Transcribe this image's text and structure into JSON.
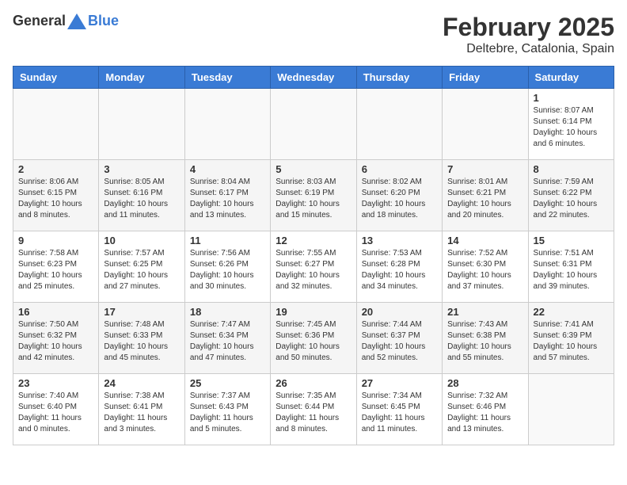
{
  "header": {
    "logo_general": "General",
    "logo_blue": "Blue",
    "month": "February 2025",
    "location": "Deltebre, Catalonia, Spain"
  },
  "days_of_week": [
    "Sunday",
    "Monday",
    "Tuesday",
    "Wednesday",
    "Thursday",
    "Friday",
    "Saturday"
  ],
  "weeks": [
    [
      {
        "day": "",
        "info": ""
      },
      {
        "day": "",
        "info": ""
      },
      {
        "day": "",
        "info": ""
      },
      {
        "day": "",
        "info": ""
      },
      {
        "day": "",
        "info": ""
      },
      {
        "day": "",
        "info": ""
      },
      {
        "day": "1",
        "info": "Sunrise: 8:07 AM\nSunset: 6:14 PM\nDaylight: 10 hours\nand 6 minutes."
      }
    ],
    [
      {
        "day": "2",
        "info": "Sunrise: 8:06 AM\nSunset: 6:15 PM\nDaylight: 10 hours\nand 8 minutes."
      },
      {
        "day": "3",
        "info": "Sunrise: 8:05 AM\nSunset: 6:16 PM\nDaylight: 10 hours\nand 11 minutes."
      },
      {
        "day": "4",
        "info": "Sunrise: 8:04 AM\nSunset: 6:17 PM\nDaylight: 10 hours\nand 13 minutes."
      },
      {
        "day": "5",
        "info": "Sunrise: 8:03 AM\nSunset: 6:19 PM\nDaylight: 10 hours\nand 15 minutes."
      },
      {
        "day": "6",
        "info": "Sunrise: 8:02 AM\nSunset: 6:20 PM\nDaylight: 10 hours\nand 18 minutes."
      },
      {
        "day": "7",
        "info": "Sunrise: 8:01 AM\nSunset: 6:21 PM\nDaylight: 10 hours\nand 20 minutes."
      },
      {
        "day": "8",
        "info": "Sunrise: 7:59 AM\nSunset: 6:22 PM\nDaylight: 10 hours\nand 22 minutes."
      }
    ],
    [
      {
        "day": "9",
        "info": "Sunrise: 7:58 AM\nSunset: 6:23 PM\nDaylight: 10 hours\nand 25 minutes."
      },
      {
        "day": "10",
        "info": "Sunrise: 7:57 AM\nSunset: 6:25 PM\nDaylight: 10 hours\nand 27 minutes."
      },
      {
        "day": "11",
        "info": "Sunrise: 7:56 AM\nSunset: 6:26 PM\nDaylight: 10 hours\nand 30 minutes."
      },
      {
        "day": "12",
        "info": "Sunrise: 7:55 AM\nSunset: 6:27 PM\nDaylight: 10 hours\nand 32 minutes."
      },
      {
        "day": "13",
        "info": "Sunrise: 7:53 AM\nSunset: 6:28 PM\nDaylight: 10 hours\nand 34 minutes."
      },
      {
        "day": "14",
        "info": "Sunrise: 7:52 AM\nSunset: 6:30 PM\nDaylight: 10 hours\nand 37 minutes."
      },
      {
        "day": "15",
        "info": "Sunrise: 7:51 AM\nSunset: 6:31 PM\nDaylight: 10 hours\nand 39 minutes."
      }
    ],
    [
      {
        "day": "16",
        "info": "Sunrise: 7:50 AM\nSunset: 6:32 PM\nDaylight: 10 hours\nand 42 minutes."
      },
      {
        "day": "17",
        "info": "Sunrise: 7:48 AM\nSunset: 6:33 PM\nDaylight: 10 hours\nand 45 minutes."
      },
      {
        "day": "18",
        "info": "Sunrise: 7:47 AM\nSunset: 6:34 PM\nDaylight: 10 hours\nand 47 minutes."
      },
      {
        "day": "19",
        "info": "Sunrise: 7:45 AM\nSunset: 6:36 PM\nDaylight: 10 hours\nand 50 minutes."
      },
      {
        "day": "20",
        "info": "Sunrise: 7:44 AM\nSunset: 6:37 PM\nDaylight: 10 hours\nand 52 minutes."
      },
      {
        "day": "21",
        "info": "Sunrise: 7:43 AM\nSunset: 6:38 PM\nDaylight: 10 hours\nand 55 minutes."
      },
      {
        "day": "22",
        "info": "Sunrise: 7:41 AM\nSunset: 6:39 PM\nDaylight: 10 hours\nand 57 minutes."
      }
    ],
    [
      {
        "day": "23",
        "info": "Sunrise: 7:40 AM\nSunset: 6:40 PM\nDaylight: 11 hours\nand 0 minutes."
      },
      {
        "day": "24",
        "info": "Sunrise: 7:38 AM\nSunset: 6:41 PM\nDaylight: 11 hours\nand 3 minutes."
      },
      {
        "day": "25",
        "info": "Sunrise: 7:37 AM\nSunset: 6:43 PM\nDaylight: 11 hours\nand 5 minutes."
      },
      {
        "day": "26",
        "info": "Sunrise: 7:35 AM\nSunset: 6:44 PM\nDaylight: 11 hours\nand 8 minutes."
      },
      {
        "day": "27",
        "info": "Sunrise: 7:34 AM\nSunset: 6:45 PM\nDaylight: 11 hours\nand 11 minutes."
      },
      {
        "day": "28",
        "info": "Sunrise: 7:32 AM\nSunset: 6:46 PM\nDaylight: 11 hours\nand 13 minutes."
      },
      {
        "day": "",
        "info": ""
      }
    ]
  ]
}
